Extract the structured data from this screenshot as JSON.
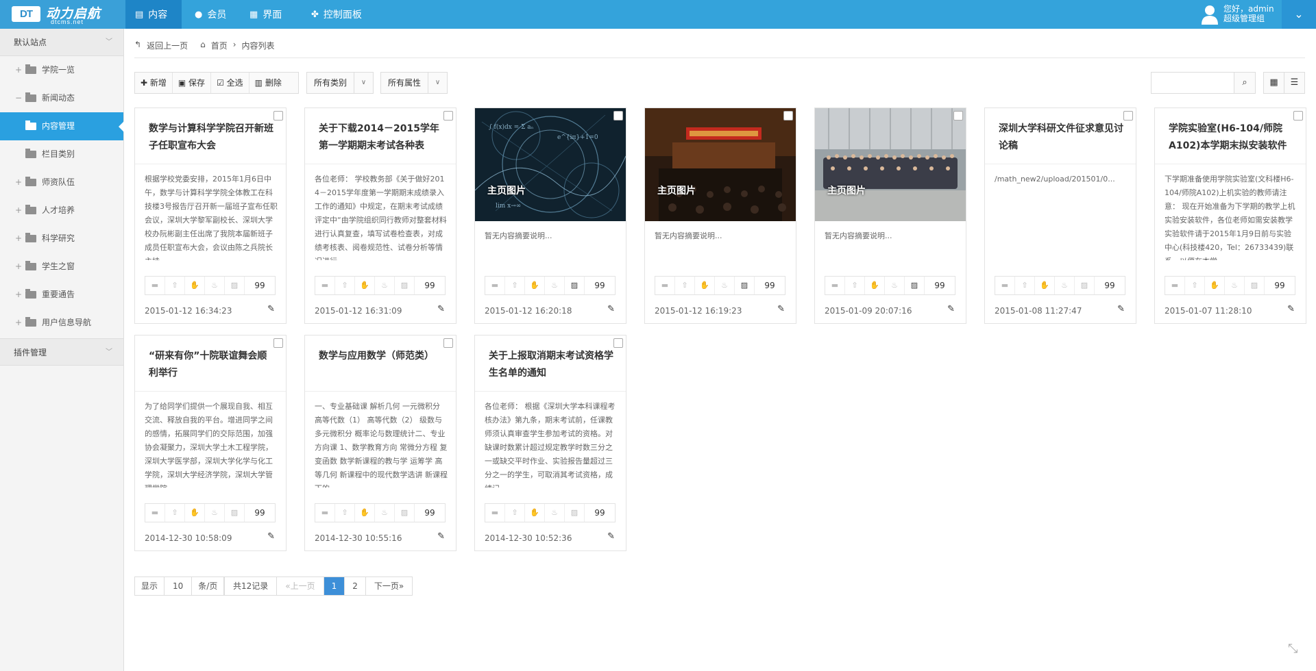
{
  "header": {
    "logo_box": "DT",
    "logo_cn": "动力启航",
    "logo_en": "dtcms.net",
    "nav": [
      {
        "label": "内容",
        "icon": "file-icon"
      },
      {
        "label": "会员",
        "icon": "user-icon"
      },
      {
        "label": "界面",
        "icon": "layout-icon"
      },
      {
        "label": "控制面板",
        "icon": "puzzle-icon"
      }
    ],
    "user_greeting": "您好，admin",
    "user_role": "超级管理组"
  },
  "sidebar": {
    "site": "默认站点",
    "items": [
      {
        "label": "学院一览",
        "pm": "+"
      },
      {
        "label": "新闻动态",
        "pm": "−"
      },
      {
        "label": "内容管理",
        "pm": ""
      },
      {
        "label": "栏目类别",
        "pm": ""
      },
      {
        "label": "师资队伍",
        "pm": "+"
      },
      {
        "label": "人才培养",
        "pm": "+"
      },
      {
        "label": "科学研究",
        "pm": "+"
      },
      {
        "label": "学生之窗",
        "pm": "+"
      },
      {
        "label": "重要通告",
        "pm": "+"
      },
      {
        "label": "用户信息导航",
        "pm": "+"
      }
    ],
    "plugins": "插件管理"
  },
  "breadcrumb": {
    "back": "返回上一页",
    "home": "首页",
    "current": "内容列表"
  },
  "toolbar": {
    "add": "新增",
    "save": "保存",
    "select_all": "全选",
    "delete": "删除",
    "category": "所有类别",
    "attribute": "所有属性"
  },
  "cards": [
    {
      "title": "数学与计算科学学院召开新班子任职宣布大会",
      "summary": "根据学校党委安排，2015年1月6日中午，数学与计算科学学院全体教工在科技楼3号报告厅召开新一届班子宣布任职会议，深圳大学黎军副校长、深圳大学校办阮彬副主任出席了我院本届新班子成员任职宣布大会，会议由陈之兵院长主持。",
      "date": "2015-01-12 16:34:23",
      "count": "99"
    },
    {
      "title": "关于下载2014－2015学年第一学期期末考试各种表",
      "summary": "各位老师： 学校教务部《关于做好2014－2015学年度第一学期期末成绩录入工作的通知》中规定，在期末考试成绩评定中“由学院组织同行教师对整套材料进行认真复查，填写试卷检查表，对成绩考核表、阅卷规范性、试卷分析等情况进行",
      "date": "2015-01-12 16:31:09",
      "count": "99"
    },
    {
      "img_label": "主页图片",
      "note": "暂无内容摘要说明...",
      "date": "2015-01-12 16:20:18",
      "count": "99"
    },
    {
      "img_label": "主页图片",
      "note": "暂无内容摘要说明...",
      "date": "2015-01-12 16:19:23",
      "count": "99"
    },
    {
      "img_label": "主页图片",
      "note": "暂无内容摘要说明...",
      "date": "2015-01-09 20:07:16",
      "count": "99"
    },
    {
      "title": "深圳大学科研文件征求意见讨论稿",
      "summary": "/math_new2/upload/201501/0...",
      "date": "2015-01-08 11:27:47",
      "count": "99"
    },
    {
      "title": "学院实验室(H6-104/师院A102)本学期末拟安装软件",
      "summary": "下学期准备使用学院实验室(文科楼H6-104/师院A102)上机实验的教师请注意： 现在开始准备为下学期的教学上机实验安装软件，各位老师如需安装教学实验软件请于2015年1月9日前与实验中心(科技楼420，Tel：26733439)联系，以便在本学",
      "date": "2015-01-07 11:28:10",
      "count": "99"
    },
    {
      "title": "“研来有你”十院联谊舞会顺利举行",
      "summary": "为了给同学们提供一个展现自我、相互交流、释放自我的平台。增进同学之间的感情，拓展同学们的交际范围，加强协会凝聚力，深圳大学土木工程学院，深圳大学医学部，深圳大学化学与化工学院，深圳大学经济学院，深圳大学管理学院，",
      "date": "2014-12-30 10:58:09",
      "count": "99"
    },
    {
      "title": "数学与应用数学（师范类）",
      "summary": "一、专业基础课 解析几何 一元微积分 高等代数（1） 高等代数（2） 级数与多元微积分 概率论与数理统计二、专业方向课 1、数学教育方向 常微分方程 复变函数 数学新课程的教与学 运筹学 高等几何 新课程中的现代数学选讲 新课程下的",
      "date": "2014-12-30 10:55:16",
      "count": "99"
    },
    {
      "title": "关于上报取消期末考试资格学生名单的通知",
      "summary": "各位老师： 根据《深圳大学本科课程考核办法》第九条，期末考试前，任课教师须认真审查学生参加考试的资格。对缺课时数累计超过规定教学时数三分之一或缺交平时作业、实验报告量超过三分之一的学生，可取消其考试资格，成绩记",
      "date": "2014-12-30 10:52:36",
      "count": "99"
    }
  ],
  "pager": {
    "show": "显示",
    "per": "10",
    "unit": "条/页",
    "total": "共12记录",
    "prev": "«上一页",
    "p1": "1",
    "p2": "2",
    "next": "下一页»"
  }
}
